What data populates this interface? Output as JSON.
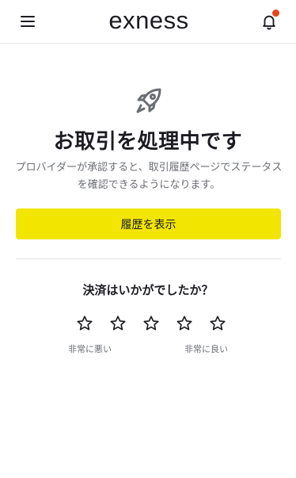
{
  "header": {
    "logo_text": "exness",
    "menu_icon": "hamburger-menu-icon",
    "notification_icon": "bell-icon",
    "notification_dot_color": "#e6441a"
  },
  "main": {
    "hero_icon": "rocket-icon",
    "title": "お取引を処理中です",
    "description": "プロバイダーが承認すると、取引履歴ページでステータスを確認できるようになります。",
    "history_button_label": "履歴を表示",
    "accent_color": "#f2e600"
  },
  "rating": {
    "question": "決済はいかがでしたか？",
    "star_count": 5,
    "low_label": "非常に悪い",
    "high_label": "非常に良い"
  }
}
